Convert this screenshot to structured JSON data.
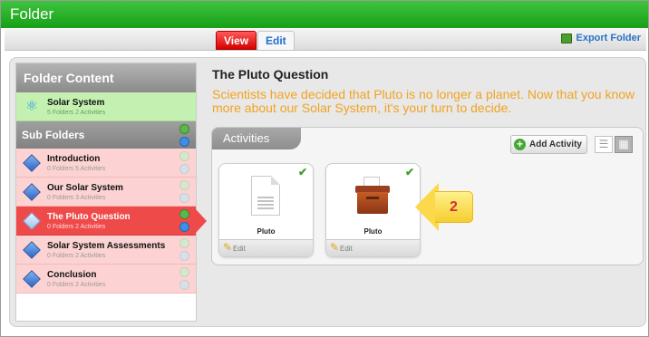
{
  "window": {
    "title": "Folder"
  },
  "toolbar": {
    "view_tab": "View",
    "edit_tab": "Edit",
    "export_label": "Export Folder"
  },
  "sidebar": {
    "heading": "Folder Content",
    "root": {
      "title": "Solar System",
      "subtitle": "5 Folders 2 Activities"
    },
    "subfolders_heading": "Sub Folders",
    "items": [
      {
        "title": "Introduction",
        "subtitle": "0 Folders 5 Activities",
        "selected": false
      },
      {
        "title": "Our Solar System",
        "subtitle": "0 Folders 3 Activities",
        "selected": false
      },
      {
        "title": "The Pluto Question",
        "subtitle": "0 Folders 2 Activities",
        "selected": true
      },
      {
        "title": "Solar System Assessments",
        "subtitle": "0 Folders 2 Activities",
        "selected": false
      },
      {
        "title": "Conclusion",
        "subtitle": "0 Folders 2 Activities",
        "selected": false
      }
    ]
  },
  "main": {
    "title": "The Pluto Question",
    "description": "Scientists have decided that Pluto is no longer a planet. Now that you know more about our Solar System, it's your turn to decide.",
    "activities_label": "Activities",
    "add_activity_label": "Add Activity",
    "cards": [
      {
        "label": "Pluto",
        "edit_label": "Edit",
        "icon": "document-icon"
      },
      {
        "label": "Pluto",
        "edit_label": "Edit",
        "icon": "ballot-box-icon"
      }
    ]
  },
  "callout": {
    "number": "2"
  },
  "colors": {
    "titlebar": "#1fa81f",
    "view_tab": "#e11b1b",
    "description": "#f2a321",
    "selected_item": "#ef4a4a",
    "root_item": "#c4f1b1"
  }
}
